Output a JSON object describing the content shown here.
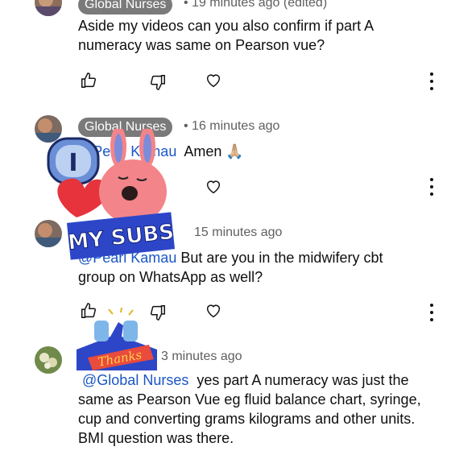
{
  "comments": [
    {
      "author": "Global Nurses",
      "time": "• 19 minutes ago (edited)",
      "text": "Aside my videos can you also confirm if part A numeracy was same on Pearson vue?"
    },
    {
      "author": "Global Nurses",
      "time": "• 16 minutes ago",
      "mention": "@Pearl Kamau",
      "text": "Amen 🙏🏼"
    },
    {
      "time": "15 minutes ago",
      "mention": "@Pearl Kamau",
      "text": "But are you in the midwifery cbt group on WhatsApp as well?"
    },
    {
      "time": "3 minutes ago",
      "mention": "@Global Nurses",
      "text": "yes part A numeracy was just the same as Pearson Vue eg fluid balance chart, syringe, cup and converting grams kilograms and other units. BMI question was there."
    }
  ],
  "stickers": {
    "mysubs": "MY SUBS",
    "thanks": "Thanks",
    "i_badge": "I"
  },
  "colors": {
    "chip": "#7a7a7a",
    "mention": "#1a56c4",
    "sticker_pink": "#f3848a",
    "sticker_blue": "#2d46c8"
  },
  "icons": [
    "thumbs-up-icon",
    "thumbs-down-icon",
    "heart-icon",
    "more-vert-icon"
  ]
}
